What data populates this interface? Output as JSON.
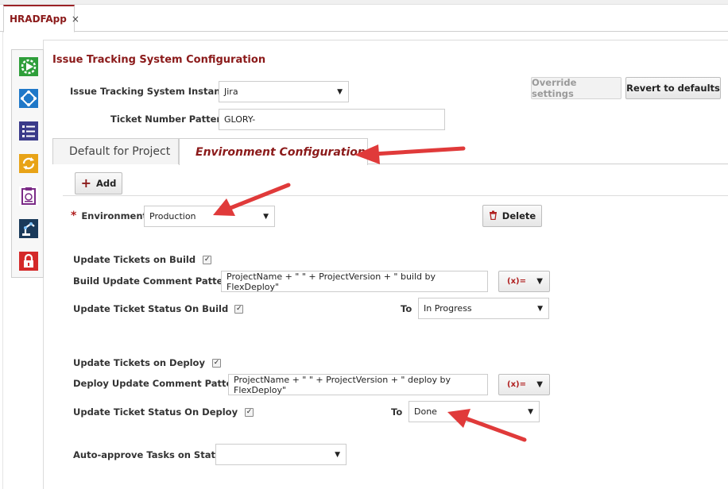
{
  "app_tab": {
    "title": "HRADFApp",
    "close": "×"
  },
  "sidebar": {
    "icons": [
      "play-gear-icon",
      "diamond-network-icon",
      "checklist-icon",
      "sync-icon",
      "project-clipboard-icon",
      "robot-arm-icon",
      "lock-icon"
    ],
    "colors": [
      "#2e9e3a",
      "#1f78c8",
      "#3a3a8a",
      "#e8a317",
      "#7a2a86",
      "#1a3a5a",
      "#d42a2a"
    ]
  },
  "header": {
    "title": "Issue Tracking System Configuration"
  },
  "its_instance": {
    "label": "Issue Tracking System Instance",
    "value": "Jira"
  },
  "ticket_pattern": {
    "label": "Ticket Number Pattern",
    "value": "GLORY-"
  },
  "buttons": {
    "override": "Override settings",
    "revert": "Revert to defaults",
    "add": "Add",
    "delete": "Delete"
  },
  "tabs": [
    {
      "label": "Default for Project"
    },
    {
      "label": "Environment Configuration"
    }
  ],
  "environment": {
    "required_mark": "*",
    "label": "Environment",
    "value": "Production"
  },
  "build": {
    "update_label": "Update Tickets on Build",
    "comment_label": "Build Update Comment Pattern",
    "comment_value": "ProjectName + \" \" + ProjectVersion + \" build by FlexDeploy\"",
    "status_label": "Update Ticket Status On Build",
    "to_label": "To",
    "to_value": "In Progress"
  },
  "deploy": {
    "update_label": "Update Tickets on Deploy",
    "comment_label": "Deploy Update Comment Pattern",
    "comment_value": "ProjectName + \" \" + ProjectVersion + \" deploy by FlexDeploy\"",
    "status_label": "Update Ticket Status On Deploy",
    "to_label": "To",
    "to_value": "Done"
  },
  "auto_approve": {
    "label": "Auto-approve Tasks on Status",
    "value": ""
  },
  "expr_button": {
    "label": "(x)="
  },
  "checkmark": "✓",
  "caret": "▼",
  "accent_color": "#8b1a1a",
  "annotation_arrow_color": "#e03a3a"
}
